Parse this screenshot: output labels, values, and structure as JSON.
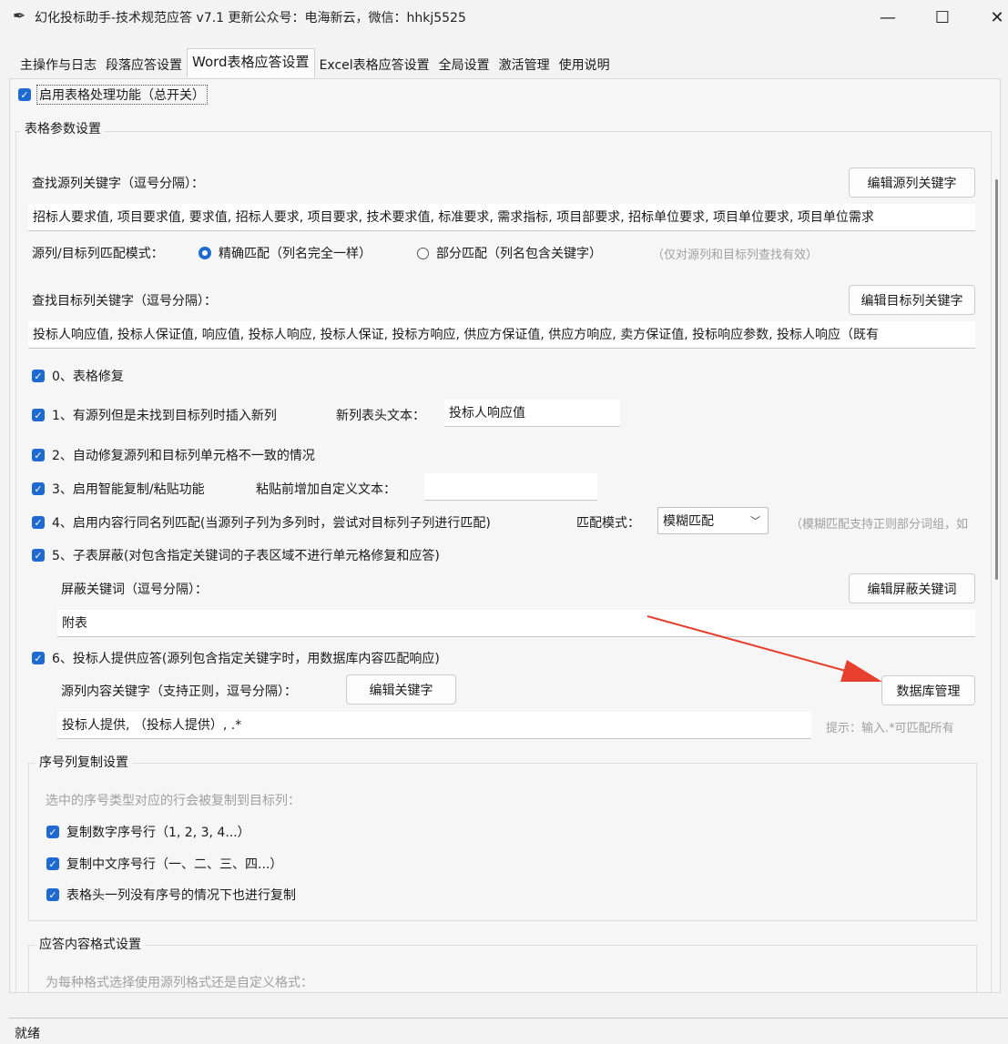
{
  "window": {
    "title": "幻化投标助手-技术规范应答 v7.1  更新公众号：电海新云，微信：hhkj5525",
    "min": "—",
    "max": "☐",
    "close": "✕"
  },
  "tabs": [
    "主操作与日志",
    "段落应答设置",
    "Word表格应答设置",
    "Excel表格应答设置",
    "全局设置",
    "激活管理",
    "使用说明"
  ],
  "active_tab_index": 2,
  "master_switch": "启用表格处理功能（总开关）",
  "table_params": {
    "group_title": "表格参数设置",
    "source_label": "查找源列关键字（逗号分隔）：",
    "edit_source_button": "编辑源列关键字",
    "source_value": "招标人要求值, 项目要求值, 要求值, 招标人要求, 项目要求, 技术要求值, 标准要求, 需求指标, 项目部要求, 招标单位要求, 项目单位要求, 项目单位需求",
    "match_mode_label": "源列/目标列匹配模式：",
    "exact_match": "精确匹配（列名完全一样）",
    "partial_match": "部分匹配（列名包含关键字）",
    "match_hint": "（仅对源列和目标列查找有效）",
    "target_label": "查找目标列关键字（逗号分隔）：",
    "edit_target_button": "编辑目标列关键字",
    "target_value": "投标人响应值, 投标人保证值, 响应值, 投标人响应, 投标人保证, 投标方响应, 供应方保证值, 供应方响应, 卖方保证值, 投标响应参数, 投标人响应（既有",
    "opt0": "0、表格修复",
    "opt1": "1、有源列但是未找到目标列时插入新列",
    "new_col_label": "新列表头文本：",
    "new_col_value": "投标人响应值",
    "opt2": "2、自动修复源列和目标列单元格不一致的情况",
    "opt3": "3、启用智能复制/粘贴功能",
    "paste_label": "粘贴前增加自定义文本：",
    "paste_value": "",
    "opt4": "4、启用内容行同名列匹配(当源列子列为多列时，尝试对目标列子列进行匹配)",
    "mode_label": "匹配模式：",
    "mode_value": "模糊匹配",
    "mode_hint": "（模糊匹配支持正则部分词组，如",
    "opt5": "5、子表屏蔽(对包含指定关键词的子表区域不进行单元格修复和应答)",
    "mask_label": "屏蔽关键词（逗号分隔）：",
    "edit_mask_button": "编辑屏蔽关键词",
    "mask_value": "附表",
    "opt6": "6、投标人提供应答(源列包含指定关键字时，用数据库内容匹配响应)",
    "src_content_label": "源列内容关键字（支持正则，逗号分隔）：",
    "edit_keyword_button": "编辑关键字",
    "db_button": "数据库管理",
    "src_content_value": "投标人提供, （投标人提供）, .*",
    "src_content_hint": "提示：输入.*可匹配所有"
  },
  "serial": {
    "group_title": "序号列复制设置",
    "desc": "选中的序号类型对应的行会被复制到目标列：",
    "opt_num": "复制数字序号行（1, 2, 3, 4...）",
    "opt_cn": "复制中文序号行（一、二、三、四...）",
    "opt_head": "表格头一列没有序号的情况下也进行复制"
  },
  "format": {
    "group_title": "应答内容格式设置",
    "desc": "为每种格式选择使用源列格式还是自定义格式："
  },
  "status": "就绪",
  "colors": {
    "accent": "#1f6ad1",
    "arrow": "#e8402f"
  }
}
